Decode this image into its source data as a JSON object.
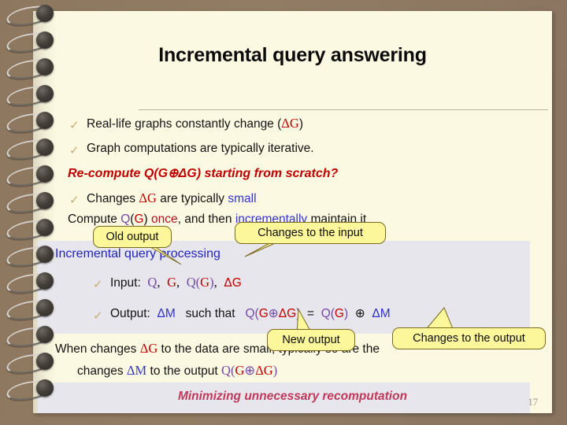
{
  "slide": {
    "title": "Incremental query answering",
    "page_number": "17",
    "bullets": [
      {
        "marker": "✓",
        "segments": [
          {
            "text": "Real-life graphs constantly change (",
            "style": "plain"
          },
          {
            "text": "ΔG",
            "style": "red-serif"
          },
          {
            "text": ")",
            "style": "plain"
          }
        ],
        "plain": "Real-life graphs constantly change (ΔG)"
      },
      {
        "marker": "✓",
        "segments": [
          {
            "text": "Graph computations are typically iterative.",
            "style": "plain"
          }
        ],
        "plain": "Graph computations are typically iterative."
      }
    ],
    "emphasis_line": "Re-compute Q(G⊕ΔG) starting from scratch?",
    "changes_line": {
      "marker": "✓",
      "prefix": "Changes ",
      "delta_g": "ΔG",
      "middle": " are typically ",
      "highlight": "small"
    },
    "compute_line": {
      "prefix": "Compute ",
      "q": "Q",
      "paren_open": "(",
      "g": "G",
      "paren_close": ")",
      "once": " once",
      "middle": ", and then ",
      "incrementally": "incrementally",
      "suffix": " maintain it"
    },
    "incremental_heading": "Incremental query processing",
    "input_line": {
      "marker": "✓",
      "label": "Input:",
      "q": "Q",
      "comma1": ",",
      "g": "G",
      "comma2": ",",
      "qg_q": "Q",
      "qg_open": "(",
      "qg_g": "G",
      "qg_close": ")",
      "comma3": ",",
      "delta_g": "ΔG"
    },
    "output_line": {
      "marker": "✓",
      "label": "Output:",
      "delta_m": "ΔM",
      "such_that": "such that",
      "lhs_q": "Q",
      "lhs_open": "(",
      "lhs_g": "G",
      "lhs_oplus": "⊕",
      "lhs_dg": "ΔG",
      "lhs_close": ")",
      "equals": "=",
      "rhs_q": "Q",
      "rhs_open": "(",
      "rhs_g": "G",
      "rhs_close": ")",
      "rhs_oplus": "⊕",
      "rhs_dm": "ΔM"
    },
    "when_line_1": {
      "prefix": "When changes ",
      "delta_g": "ΔG",
      "suffix": " to the data are small, typically so are the"
    },
    "when_line_2": {
      "prefix": "changes ",
      "delta_m": "ΔM",
      "middle": " to the output ",
      "q": "Q",
      "open": "(",
      "g": "G",
      "oplus": "⊕",
      "dg": "ΔG",
      "close": ")"
    },
    "banner": "Minimizing unnecessary recomputation"
  },
  "callouts": [
    {
      "id": "old-output",
      "label": "Old output"
    },
    {
      "id": "changes-to-input",
      "label": "Changes to the input"
    },
    {
      "id": "new-output",
      "label": "New output"
    },
    {
      "id": "changes-to-output",
      "label": "Changes to the output"
    }
  ],
  "colors": {
    "page": "#fbf9e2",
    "backdrop": "#8a7560",
    "panel": "#e6e6ec",
    "callout_fill": "#fdf79c",
    "callout_border": "#7c6a20",
    "red": "#c00000",
    "blue": "#3333cc",
    "purple": "#7648a8",
    "heading_blue": "#2222bb",
    "banner_pink": "#c0385a",
    "tick": "#c8ab78"
  }
}
